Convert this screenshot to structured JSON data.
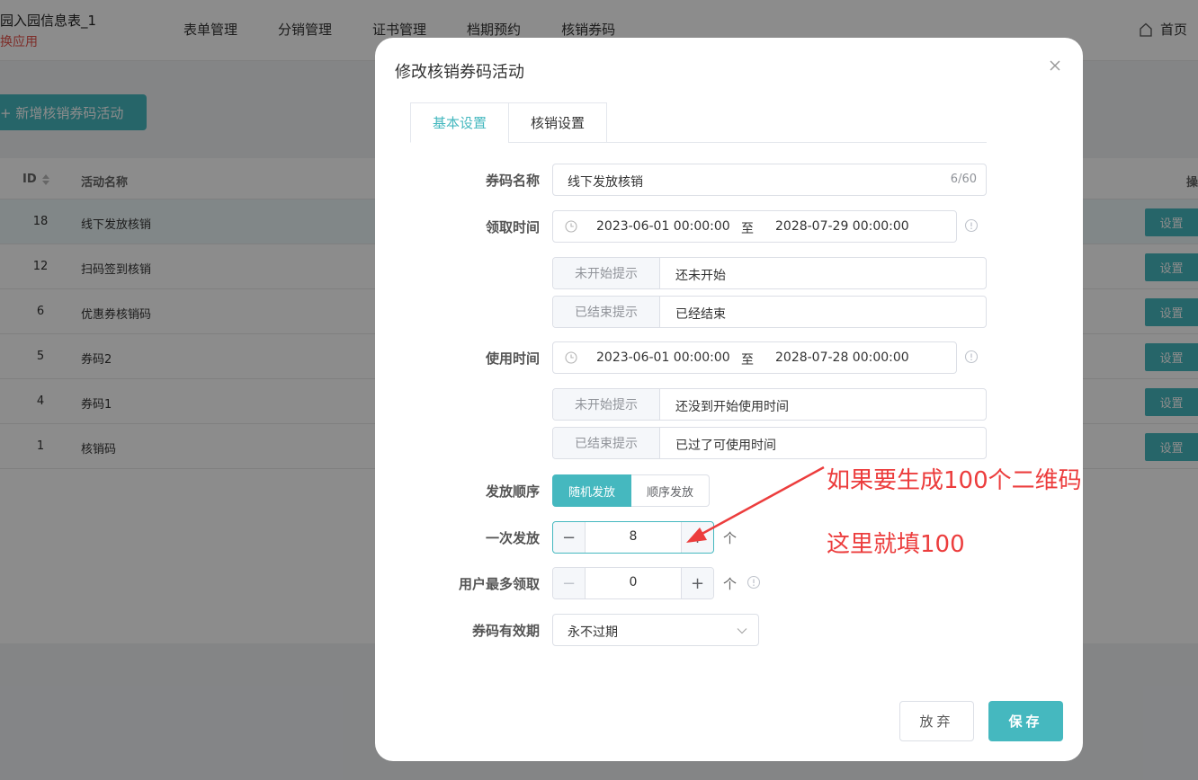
{
  "header": {
    "app_title": "园入园信息表_1",
    "app_switch": "换应用",
    "nav": [
      "表单管理",
      "分销管理",
      "证书管理",
      "档期预约",
      "核销券码"
    ],
    "home_label": "首页"
  },
  "page": {
    "add_button": "+ 新增核销券码活动",
    "table": {
      "columns": [
        "ID",
        "活动名称",
        "操"
      ],
      "rows": [
        {
          "id": "18",
          "name": "线下发放核销",
          "op": "设置"
        },
        {
          "id": "12",
          "name": "扫码签到核销",
          "op": "设置"
        },
        {
          "id": "6",
          "name": "优惠券核销码",
          "op": "设置"
        },
        {
          "id": "5",
          "name": "券码2",
          "op": "设置"
        },
        {
          "id": "4",
          "name": "券码1",
          "op": "设置"
        },
        {
          "id": "1",
          "name": "核销码",
          "op": "设置"
        }
      ]
    }
  },
  "dialog": {
    "title": "修改核销券码活动",
    "tabs": [
      "基本设置",
      "核销设置"
    ],
    "code_name": {
      "label": "券码名称",
      "value": "线下发放核销",
      "count": "6/60"
    },
    "receive_time": {
      "label": "领取时间",
      "start": "2023-06-01 00:00:00",
      "separator": "至",
      "end": "2028-07-29 00:00:00",
      "not_started_label": "未开始提示",
      "not_started_value": "还未开始",
      "ended_label": "已结束提示",
      "ended_value": "已经结束"
    },
    "use_time": {
      "label": "使用时间",
      "start": "2023-06-01 00:00:00",
      "separator": "至",
      "end": "2028-07-28 00:00:00",
      "not_started_label": "未开始提示",
      "not_started_value": "还没到开始使用时间",
      "ended_label": "已结束提示",
      "ended_value": "已过了可使用时间"
    },
    "issue_order": {
      "label": "发放顺序",
      "options": [
        "随机发放",
        "顺序发放"
      ],
      "selected": "随机发放"
    },
    "per_issue": {
      "label": "一次发放",
      "value": "8",
      "unit": "个"
    },
    "user_max": {
      "label": "用户最多领取",
      "value": "0",
      "unit": "个"
    },
    "validity": {
      "label": "券码有效期",
      "value": "永不过期"
    },
    "cancel_button": "放弃",
    "save_button": "保存"
  },
  "annotation": {
    "line1": "如果要生成100个二维码",
    "line2": "这里就填100",
    "color": "#ec3d3d"
  },
  "colors": {
    "accent": "#45b8bf",
    "overlay": "rgba(0,0,0,0.45)"
  }
}
